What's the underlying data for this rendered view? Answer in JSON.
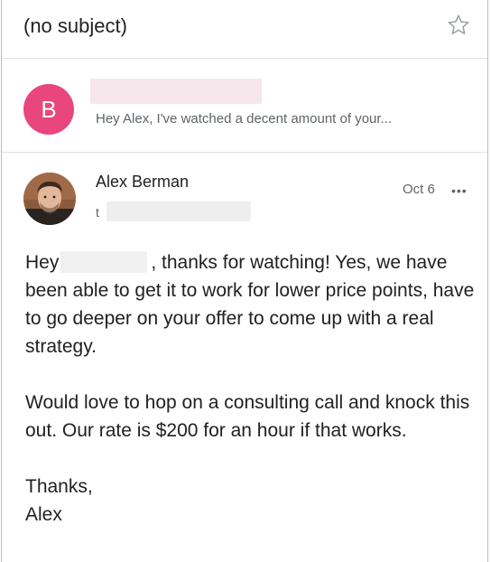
{
  "subject": "(no subject)",
  "first_message": {
    "avatar_letter": "B",
    "avatar_color": "#e8467c",
    "snippet": "Hey Alex, I've watched a decent amount of your..."
  },
  "reply": {
    "sender": "Alex Berman",
    "to_prefix": "t",
    "date": "Oct 6",
    "more": "•••",
    "greeting_start": "Hey",
    "greeting_rest": ", thanks for watching! Yes, we have been able to get it to work for lower price points, have to go deeper on your offer to come up with a real strategy.",
    "paragraph2": "Would love to hop on a consulting call and knock this out. Our rate is $200 for an hour if that works.",
    "signoff": "Thanks,",
    "signature": "Alex"
  },
  "icons": {
    "star": "star-icon",
    "more": "more-horizontal-icon"
  }
}
